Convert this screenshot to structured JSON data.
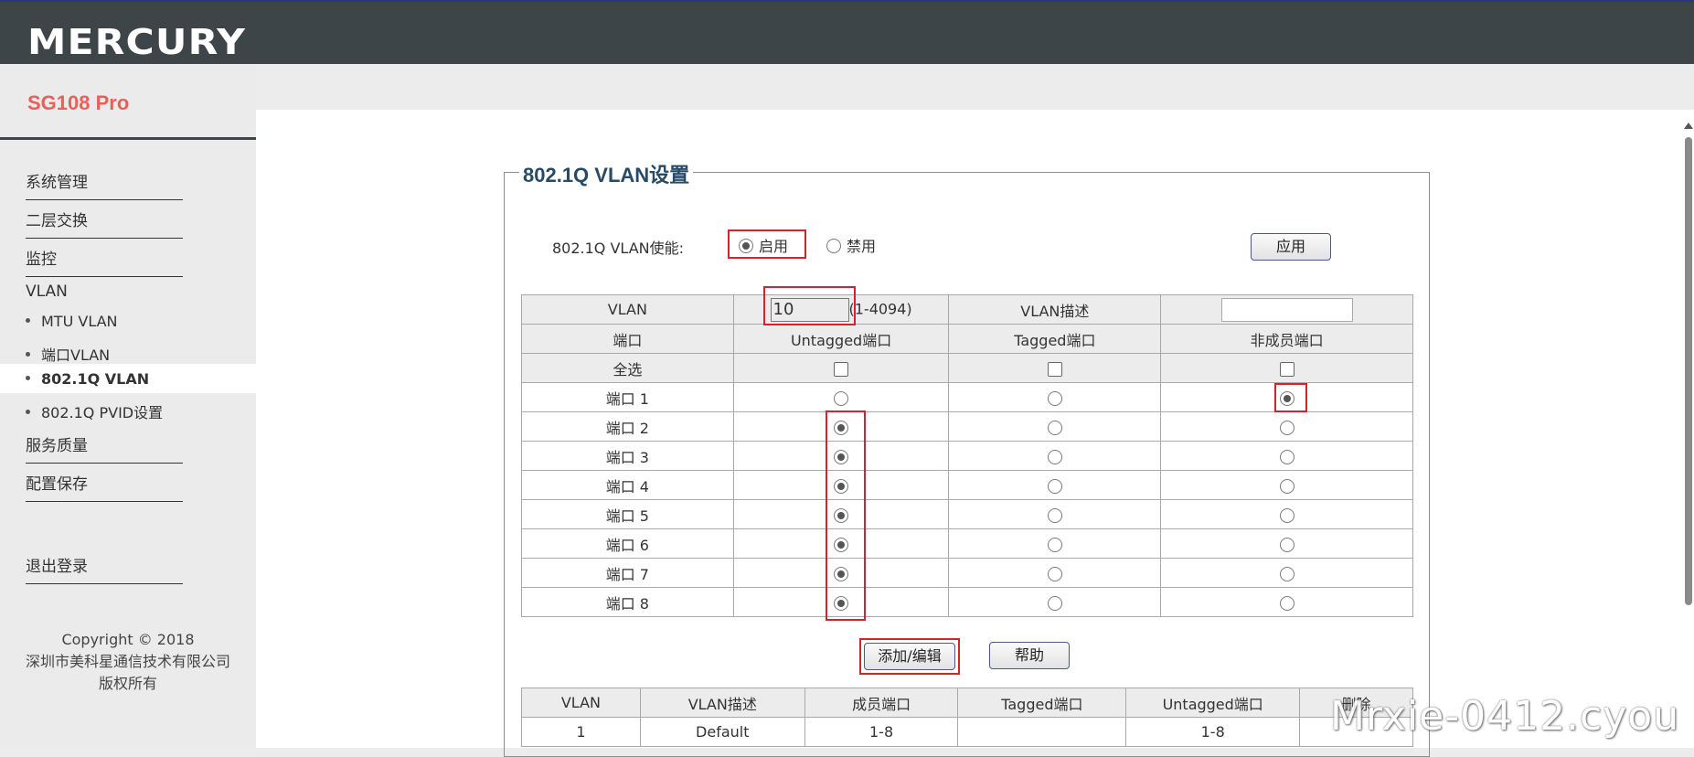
{
  "brand": {
    "logo": "MERCURY",
    "model": "SG108 Pro"
  },
  "sidebar": {
    "items": [
      {
        "label": "系统管理"
      },
      {
        "label": "二层交换"
      },
      {
        "label": "监控"
      }
    ],
    "vlan_group": "VLAN",
    "vlan_sub": [
      {
        "label": "MTU VLAN"
      },
      {
        "label": "端口VLAN"
      },
      {
        "label": "802.1Q VLAN",
        "active": true
      },
      {
        "label": "802.1Q PVID设置"
      }
    ],
    "items2": [
      {
        "label": "服务质量"
      },
      {
        "label": "配置保存"
      }
    ],
    "logout": "退出登录",
    "copyright": [
      "Copyright © 2018",
      "深圳市美科星通信技术有限公司",
      "版权所有"
    ]
  },
  "panel": {
    "title": "802.1Q VLAN设置",
    "enable_label": "802.1Q VLAN使能:",
    "enable_option": "启用",
    "disable_option": "禁用",
    "enabled": true,
    "apply_button": "应用"
  },
  "config_table": {
    "vlan_label": "VLAN",
    "vlan_id_value": "10",
    "vlan_range": "(1-4094)",
    "desc_label": "VLAN描述",
    "desc_value": "",
    "port_header": "端口",
    "untagged_header": "Untagged端口",
    "tagged_header": "Tagged端口",
    "nonmember_header": "非成员端口",
    "select_all": "全选",
    "ports": [
      {
        "label": "端口 1",
        "mode": "nonmember"
      },
      {
        "label": "端口 2",
        "mode": "untagged"
      },
      {
        "label": "端口 3",
        "mode": "untagged"
      },
      {
        "label": "端口 4",
        "mode": "untagged"
      },
      {
        "label": "端口 5",
        "mode": "untagged"
      },
      {
        "label": "端口 6",
        "mode": "untagged"
      },
      {
        "label": "端口 7",
        "mode": "untagged"
      },
      {
        "label": "端口 8",
        "mode": "untagged"
      }
    ],
    "add_button": "添加/编辑",
    "help_button": "帮助"
  },
  "vlan_list": {
    "headers": [
      "VLAN",
      "VLAN描述",
      "成员端口",
      "Tagged端口",
      "Untagged端口",
      "删除"
    ],
    "rows": [
      [
        "1",
        "Default",
        "1-8",
        "",
        "1-8",
        ""
      ]
    ]
  },
  "watermark": "Mrxie-0412.cyou",
  "colors": {
    "header_bg": "#3d4549",
    "model_red": "#e9605a",
    "title_blue": "#274b66",
    "highlight_red": "#d1242c"
  }
}
